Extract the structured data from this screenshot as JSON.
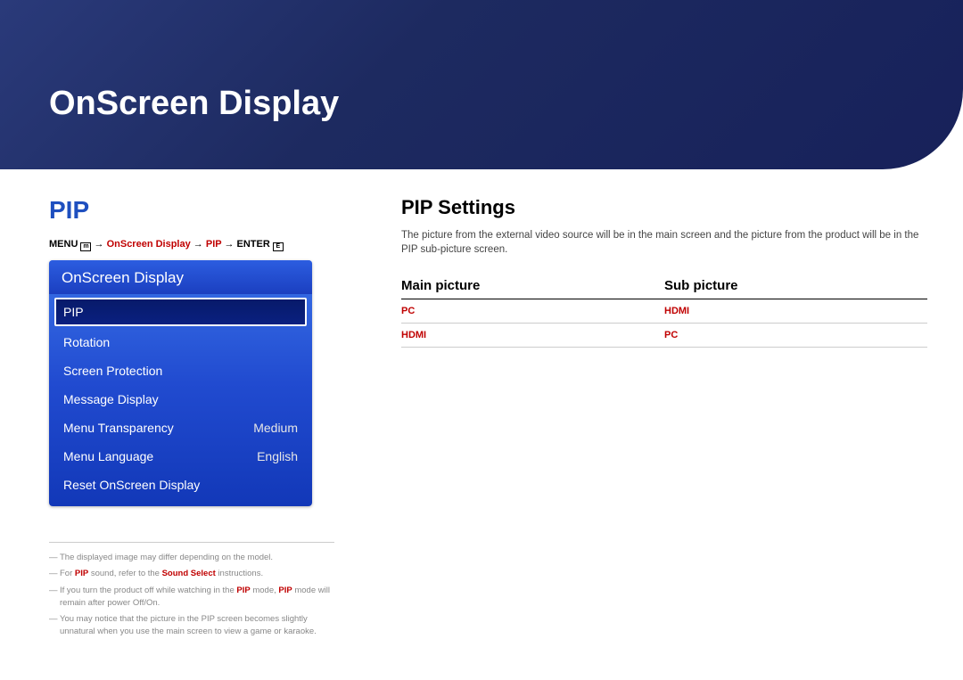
{
  "header": {
    "title": "OnScreen Display"
  },
  "left": {
    "title": "PIP",
    "breadcrumb": {
      "menu": "MENU",
      "arrow": "→",
      "part1": "OnScreen Display",
      "part2": "PIP",
      "enter": "ENTER"
    },
    "menu": {
      "header": "OnScreen Display",
      "items": [
        {
          "label": "PIP",
          "value": "",
          "selected": true
        },
        {
          "label": "Rotation",
          "value": ""
        },
        {
          "label": "Screen Protection",
          "value": ""
        },
        {
          "label": "Message Display",
          "value": ""
        },
        {
          "label": "Menu Transparency",
          "value": "Medium"
        },
        {
          "label": "Menu Language",
          "value": "English"
        },
        {
          "label": "Reset OnScreen Display",
          "value": ""
        }
      ]
    },
    "footnotes": [
      {
        "pre": "The displayed image may differ depending on the model."
      },
      {
        "pre": "For ",
        "hl1": "PIP",
        "mid": " sound, refer to the ",
        "hl2": "Sound Select",
        "post": " instructions."
      },
      {
        "pre": "If you turn the product off while watching in the ",
        "hl1": "PIP",
        "mid": " mode, ",
        "hl2": "PIP",
        "post": " mode will remain after power Off/On."
      },
      {
        "pre": "You may notice that the picture in the PIP screen becomes slightly unnatural when you use the main screen to view a game or karaoke."
      }
    ]
  },
  "right": {
    "heading": "PIP Settings",
    "desc": "The picture from the external video source will be in the main screen and the picture from the product will be in the PIP sub-picture screen.",
    "table": {
      "headers": [
        "Main picture",
        "Sub picture"
      ],
      "rows": [
        [
          "PC",
          "HDMI"
        ],
        [
          "HDMI",
          "PC"
        ]
      ]
    }
  }
}
